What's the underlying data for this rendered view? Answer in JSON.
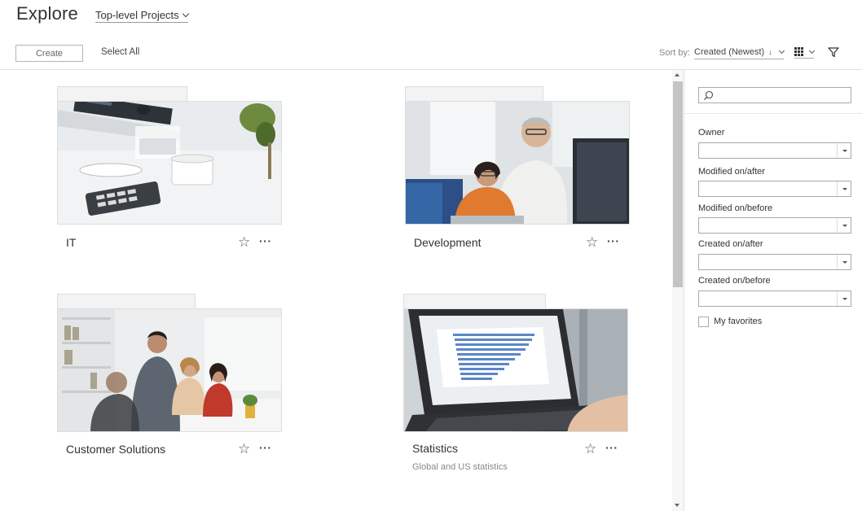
{
  "header": {
    "title": "Explore",
    "project_selector": "Top-level Projects"
  },
  "toolbar": {
    "create_label": "Create",
    "select_all_label": "Select All",
    "sort_label": "Sort by:",
    "sort_value": "Created (Newest)",
    "sort_direction_glyph": "↓",
    "view_icon": "grid-icon",
    "filter_icon": "filter-icon"
  },
  "projects": [
    {
      "name": "IT",
      "description": "",
      "image": "office-desk-photo"
    },
    {
      "name": "Development",
      "description": "",
      "image": "developers-at-monitor-photo"
    },
    {
      "name": "Customer Solutions",
      "description": "",
      "image": "team-meeting-photo"
    },
    {
      "name": "Statistics",
      "description": "Global and US statistics",
      "image": "laptop-dashboard-photo"
    }
  ],
  "card_actions": {
    "star_glyph": "☆",
    "more_glyph": "···"
  },
  "filters": {
    "search_placeholder": "",
    "owner_label": "Owner",
    "modified_after_label": "Modified on/after",
    "modified_before_label": "Modified on/before",
    "created_after_label": "Created on/after",
    "created_before_label": "Created on/before",
    "favorites_label": "My favorites",
    "favorites_checked": false
  },
  "colors": {
    "accent": "#333333",
    "border": "#dddddd",
    "scrollbar_thumb": "#c4c4c4"
  }
}
